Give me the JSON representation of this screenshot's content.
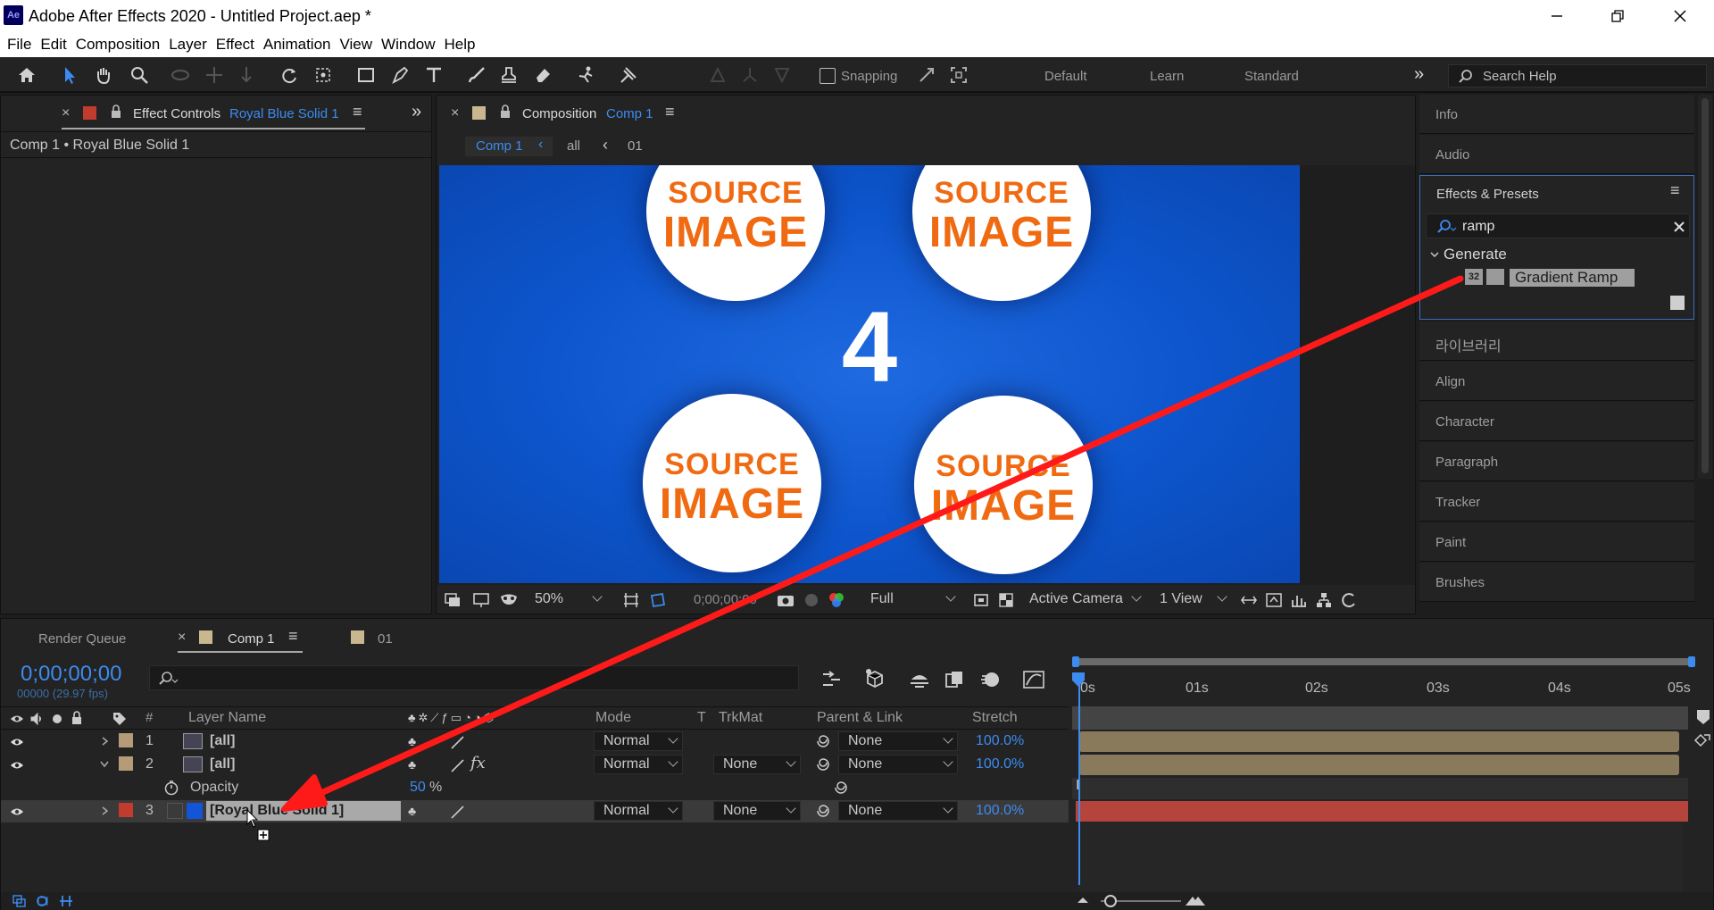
{
  "app": {
    "icon_label": "Ae",
    "title": "Adobe After Effects 2020 - Untitled Project.aep *"
  },
  "menu": [
    "File",
    "Edit",
    "Composition",
    "Layer",
    "Effect",
    "Animation",
    "View",
    "Window",
    "Help"
  ],
  "toolbar": {
    "snapping_label": "Snapping",
    "workspaces": [
      "Default",
      "Learn",
      "Standard"
    ],
    "search_placeholder": "Search Help"
  },
  "effect_controls": {
    "title": "Effect Controls",
    "layer": "Royal Blue Solid 1",
    "breadcrumb": "Comp 1 • Royal Blue Solid 1"
  },
  "composition_panel": {
    "title": "Composition",
    "comp": "Comp 1",
    "nav_items": [
      "Comp 1",
      "all",
      "01"
    ],
    "number_text": "4",
    "source_line1": "SOURCE",
    "source_line2": "IMAGE",
    "zoom": "50%",
    "timecode": "0;00;00;00",
    "resolution": "Full",
    "camera": "Active Camera",
    "view_count": "1 View"
  },
  "right_panels": {
    "info": "Info",
    "audio": "Audio",
    "effects_presets": "Effects & Presets",
    "search_value": "ramp",
    "group": "Generate",
    "effect_badge": "32",
    "effect_name": "Gradient Ramp",
    "library": "라이브러리",
    "align": "Align",
    "character": "Character",
    "paragraph": "Paragraph",
    "tracker": "Tracker",
    "paint": "Paint",
    "brushes": "Brushes"
  },
  "timeline": {
    "tabs": [
      "Render Queue",
      "Comp 1",
      "01"
    ],
    "timecode": "0;00;00;00",
    "frame_info": "00000 (29.97 fps)",
    "columns": {
      "num": "#",
      "layer_name": "Layer Name",
      "mode": "Mode",
      "t": "T",
      "trkmat": "TrkMat",
      "parent": "Parent & Link",
      "stretch": "Stretch"
    },
    "layers": [
      {
        "num": "1",
        "name": "[all]",
        "mode": "Normal",
        "trkmat": "",
        "parent": "None",
        "stretch": "100.0%",
        "label_color": "#b59b78"
      },
      {
        "num": "2",
        "name": "[all]",
        "mode": "Normal",
        "trkmat": "None",
        "parent": "None",
        "stretch": "100.0%",
        "label_color": "#b59b78",
        "fx": "fx"
      },
      {
        "num": "3",
        "name": "[Royal Blue Solid 1]",
        "mode": "Normal",
        "trkmat": "None",
        "parent": "None",
        "stretch": "100.0%",
        "label_color": "#c23b2f"
      }
    ],
    "opacity": {
      "label": "Opacity",
      "value": "50",
      "unit": "%"
    },
    "ruler": [
      "0s",
      "01s",
      "02s",
      "03s",
      "04s",
      "05s"
    ]
  },
  "colors": {
    "accent": "#3c8bf0",
    "comp_bg": "#0f55c8",
    "arrow": "#ff1a1a",
    "layer_bar_tan": "#8a7a5c",
    "layer_bar_red": "#b5453c"
  }
}
